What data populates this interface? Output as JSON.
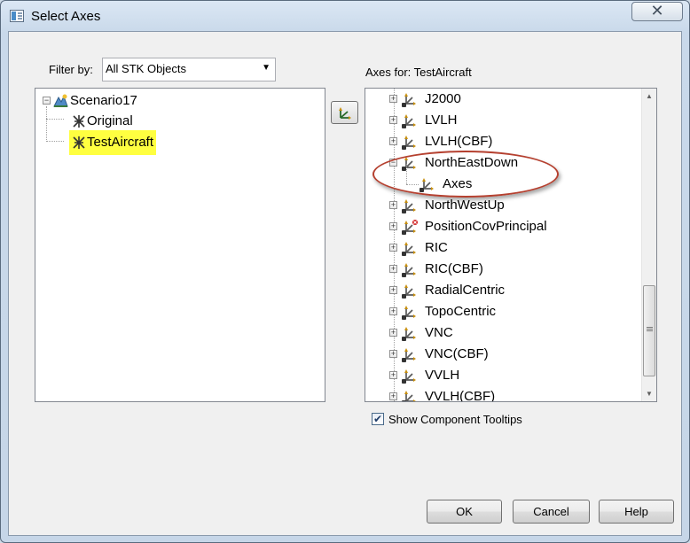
{
  "window": {
    "title": "Select Axes",
    "close_glyph": "✕"
  },
  "filter": {
    "label": "Filter by:",
    "value": "All STK Objects"
  },
  "axes_for_label": "Axes for: TestAircraft",
  "left_tree": [
    {
      "label": "Scenario17",
      "icon": "scenario-icon",
      "expanded": true
    },
    {
      "label": "Original",
      "icon": "aircraft-icon"
    },
    {
      "label": "TestAircraft",
      "icon": "aircraft-icon",
      "highlighted": true
    }
  ],
  "right_tree": [
    {
      "label": "J2000",
      "icon": "axes-icon"
    },
    {
      "label": "LVLH",
      "icon": "axes-icon"
    },
    {
      "label": "LVLH(CBF)",
      "icon": "axes-icon"
    },
    {
      "label": "NorthEastDown",
      "icon": "axes-icon",
      "expanded": true
    },
    {
      "label": "Axes",
      "icon": "axes-child-icon",
      "child": true
    },
    {
      "label": "NorthWestUp",
      "icon": "axes-icon"
    },
    {
      "label": "PositionCovPrincipal",
      "icon": "axes-error-icon"
    },
    {
      "label": "RIC",
      "icon": "axes-icon"
    },
    {
      "label": "RIC(CBF)",
      "icon": "axes-icon"
    },
    {
      "label": "RadialCentric",
      "icon": "axes-icon"
    },
    {
      "label": "TopoCentric",
      "icon": "axes-icon"
    },
    {
      "label": "VNC",
      "icon": "axes-icon"
    },
    {
      "label": "VNC(CBF)",
      "icon": "axes-icon"
    },
    {
      "label": "VVLH",
      "icon": "axes-icon"
    },
    {
      "label": "VVLH(CBF)",
      "icon": "axes-icon"
    }
  ],
  "show_tooltips": {
    "label": "Show Component Tooltips",
    "checked": true
  },
  "buttons": {
    "ok": "OK",
    "cancel": "Cancel",
    "help": "Help"
  },
  "colors": {
    "highlight": "#ffff40",
    "annotation_ellipse": "#b5402f"
  }
}
